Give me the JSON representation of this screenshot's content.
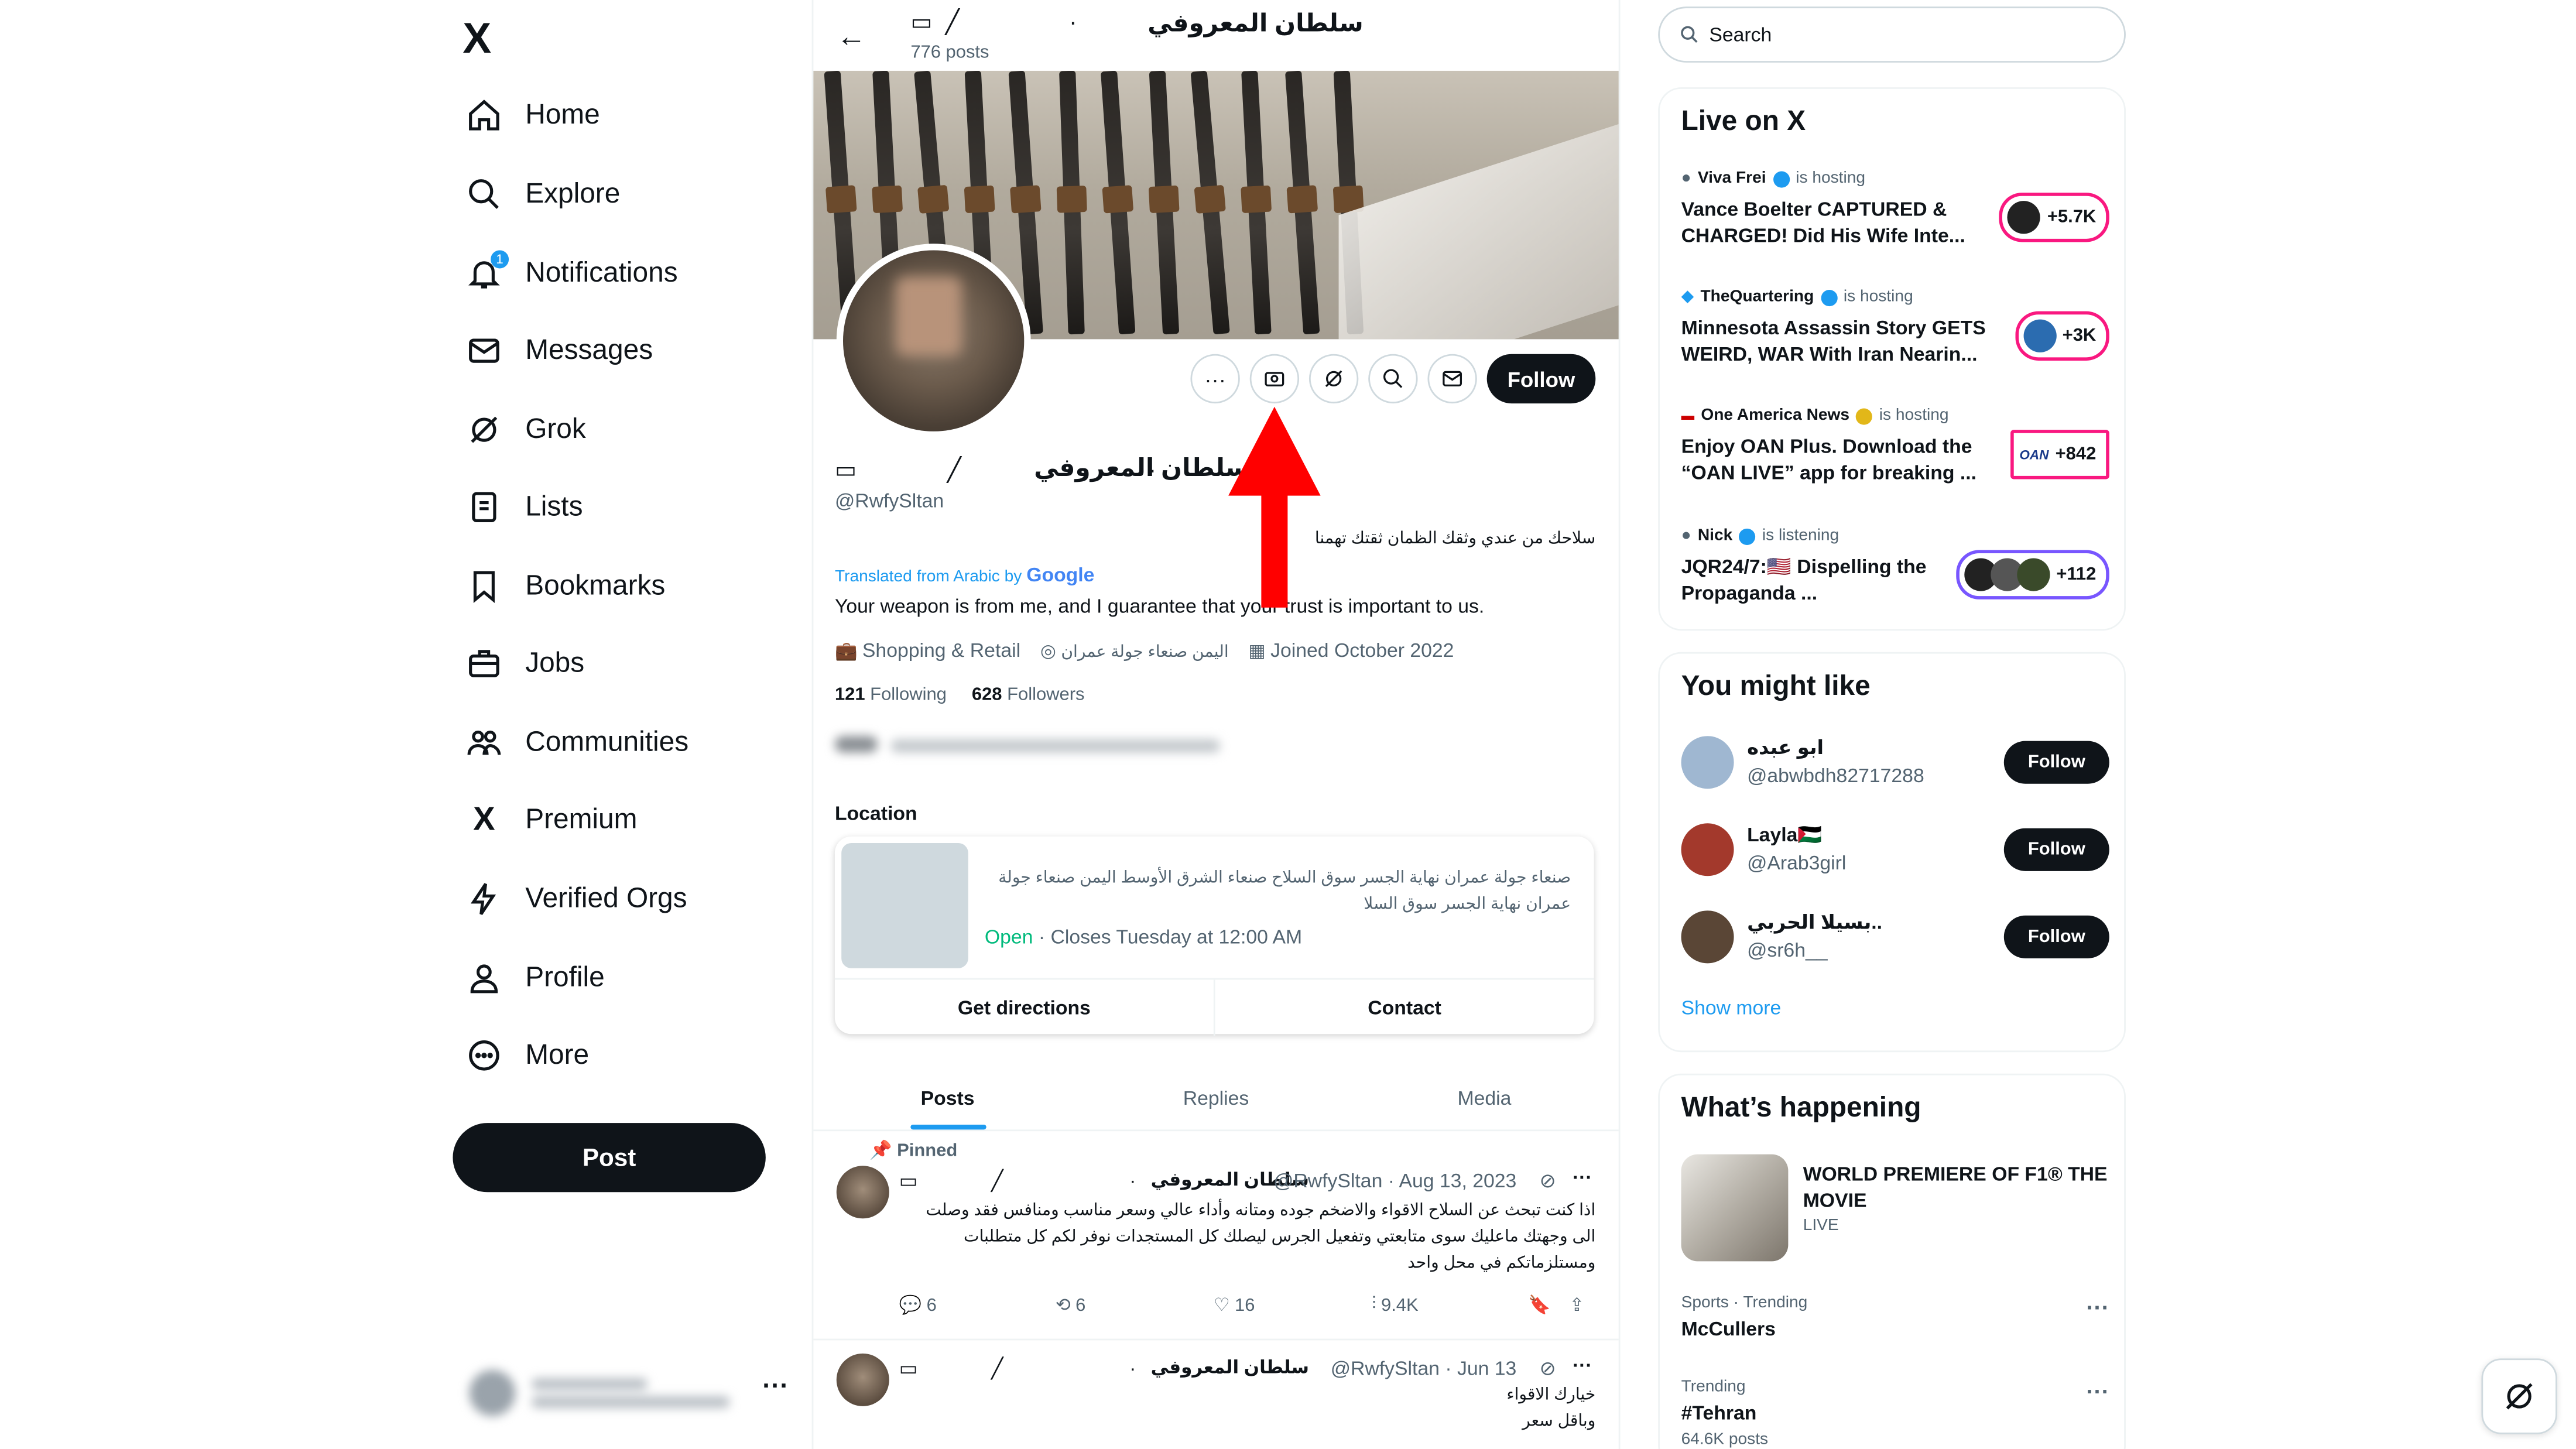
{
  "nav": {
    "logo": "X",
    "items": [
      {
        "label": "Home",
        "icon": "home-icon"
      },
      {
        "label": "Explore",
        "icon": "search-icon"
      },
      {
        "label": "Notifications",
        "icon": "bell-icon",
        "badge": "1"
      },
      {
        "label": "Messages",
        "icon": "mail-icon"
      },
      {
        "label": "Grok",
        "icon": "grok-icon"
      },
      {
        "label": "Lists",
        "icon": "list-icon"
      },
      {
        "label": "Bookmarks",
        "icon": "bookmark-icon"
      },
      {
        "label": "Jobs",
        "icon": "briefcase-icon"
      },
      {
        "label": "Communities",
        "icon": "people-icon"
      },
      {
        "label": "Premium",
        "icon": "x-logo-icon"
      },
      {
        "label": "Verified Orgs",
        "icon": "lightning-icon"
      },
      {
        "label": "Profile",
        "icon": "person-icon"
      },
      {
        "label": "More",
        "icon": "more-circle-icon"
      }
    ],
    "post_label": "Post"
  },
  "profile": {
    "top_name": "سلطان المعروفي",
    "post_count": "776 posts",
    "follow_label": "Follow",
    "display_name": "سلطان المعروفي",
    "handle": "@RwfySltan",
    "bio": "سلاحك من عندي وثقك الظمان ثقتك تهمنا",
    "translated_prefix": "Translated from Arabic by",
    "translated_brand": "Google",
    "bio_translated": "Your weapon is from me, and I guarantee that your trust is important to us.",
    "category": "Shopping & Retail",
    "location": "اليمن صنعاء جولة عمران",
    "joined": "Joined October 2022",
    "following_count": "121",
    "following_label": "Following",
    "followers_count": "628",
    "followers_label": "Followers"
  },
  "location_card": {
    "heading": "Location",
    "address": "صنعاء جولة عمران نهاية الجسر سوق السلاح صنعاء الشرق الأوسط اليمن صنعاء جولة عمران نهاية الجسر سوق السلا",
    "open_label": "Open",
    "hours": "· Closes Tuesday at 12:00 AM",
    "directions_label": "Get directions",
    "contact_label": "Contact"
  },
  "tabs": [
    "Posts",
    "Replies",
    "Media"
  ],
  "pinned_label": "Pinned",
  "tweets": [
    {
      "name": "سلطان المعروفي",
      "handle_date": "@RwfySltan · Aug 13, 2023",
      "text": "اذا كنت تبحث عن السلاح الاقواء والاضخم جوده ومتانه وأداء عالي وسعر مناسب ومنافس فقد وصلت الى وجهتك ماعليك سوى متابعتي وتفعيل الجرس ليصلك كل المستجدات نوفر لكم كل متطلبات ومستلزماتكم في محل واحد",
      "replies": "6",
      "reposts": "6",
      "likes": "16",
      "views": "9.4K"
    },
    {
      "name": "سلطان المعروفي",
      "handle_date": "@RwfySltan · Jun 13",
      "text": "خيارك الاقواء وباقل سعر"
    }
  ],
  "right": {
    "search_placeholder": "Search",
    "live_title": "Live on X",
    "live": [
      {
        "host": "Viva Frei",
        "status": "is hosting",
        "title": "Vance Boelter CAPTURED & CHARGED! Did His Wife Inte...",
        "count": "+5.7K"
      },
      {
        "host": "TheQuartering",
        "status": "is hosting",
        "title": "Minnesota Assassin Story GETS WEIRD, WAR With Iran Nearin...",
        "count": "+3K"
      },
      {
        "host": "One America News",
        "status": "is hosting",
        "title": "Enjoy OAN Plus. Download the “OAN LIVE” app for breaking ...",
        "count": "+842",
        "logo": "OAN"
      },
      {
        "host": "Nick",
        "status": "is listening",
        "title": "JQR24/7:🇺🇸 Dispelling the Propaganda ...",
        "count": "+112"
      }
    ],
    "wtf_title": "You might like",
    "wtf": [
      {
        "name": "ابو عبده",
        "handle": "@abwbdh82717288"
      },
      {
        "name": "Layla🇵🇸",
        "handle": "@Arab3girl"
      },
      {
        "name": "بسيلا الحربي..",
        "handle": "@sr6h__"
      }
    ],
    "wtf_follow": "Follow",
    "show_more": "Show more",
    "happening_title": "What’s happening",
    "headline": {
      "title": "WORLD PREMIERE OF F1® THE MOVIE",
      "status": "LIVE"
    },
    "trends": [
      {
        "category": "Sports · Trending",
        "name": "McCullers"
      },
      {
        "category": "Trending",
        "name": "#Tehran",
        "count": "64.6K posts"
      }
    ]
  },
  "colors": {
    "accent": "#1d9bf0",
    "live_pink": "#f91880",
    "annotation_arrow": "#ff0000",
    "open_green": "#00ba7c"
  }
}
